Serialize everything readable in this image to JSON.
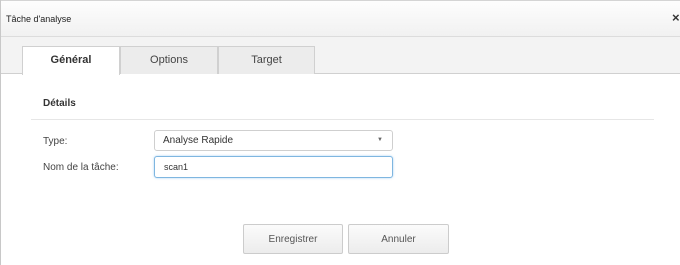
{
  "dialog": {
    "title": "Tâche d'analyse",
    "close_glyph": "×"
  },
  "tabs": [
    {
      "label": "Général",
      "active": true
    },
    {
      "label": "Options",
      "active": false
    },
    {
      "label": "Target",
      "active": false
    }
  ],
  "details": {
    "section_title": "Détails",
    "type_label": "Type:",
    "type_value": "Analyse Rapide",
    "name_label": "Nom de la tâche:",
    "name_value": "scan1"
  },
  "buttons": {
    "save_label": "Enregistrer",
    "cancel_label": "Annuler"
  },
  "icons": {
    "close": "close-icon",
    "dropdown": "chevron-down-icon"
  },
  "colors": {
    "focus_border": "#7fb6e0",
    "tab_active_bg": "#ffffff",
    "tab_inactive_bg": "#ececec"
  }
}
